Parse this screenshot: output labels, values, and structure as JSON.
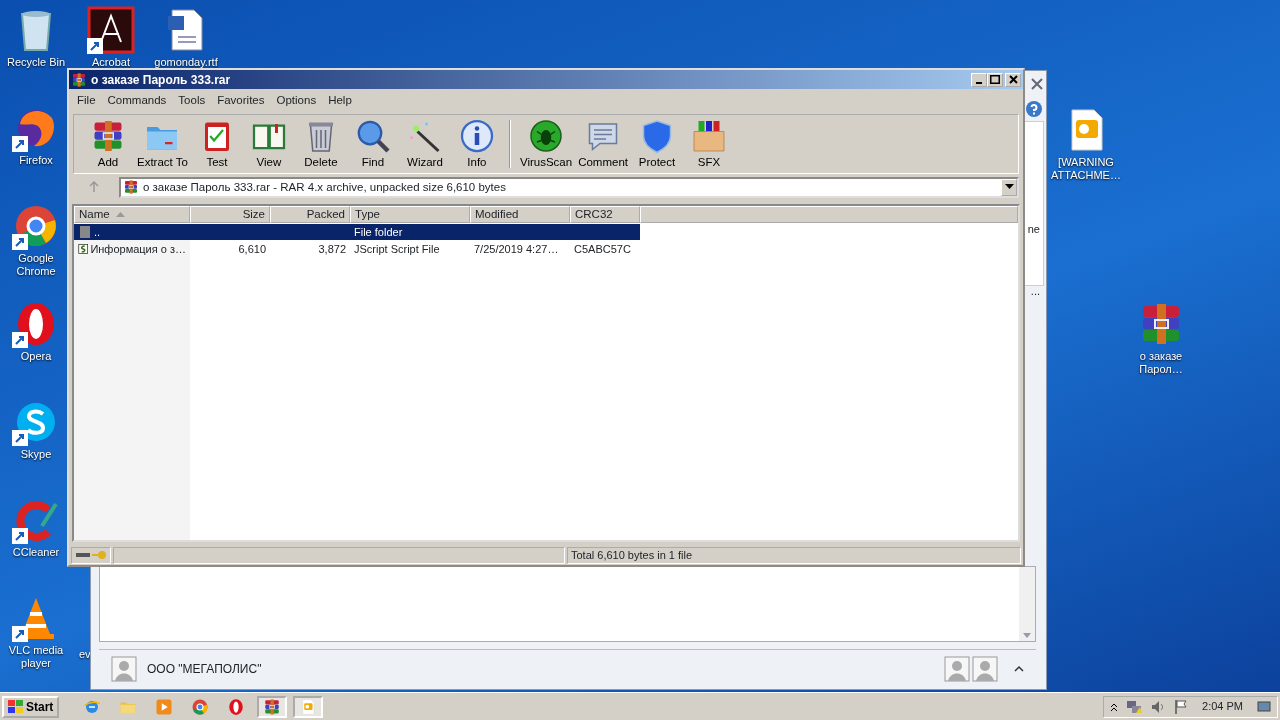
{
  "desktop_icons": [
    {
      "label": "Recycle Bin",
      "kind": "recycle",
      "shortcut": false
    },
    {
      "label": "Acrobat",
      "kind": "pdf",
      "shortcut": true
    },
    {
      "label": "gomonday.rtf",
      "kind": "doc",
      "shortcut": false
    },
    {
      "label": "Firefox",
      "kind": "firefox",
      "shortcut": true
    },
    {
      "label": "Google Chrome",
      "kind": "chrome",
      "shortcut": true
    },
    {
      "label": "Opera",
      "kind": "opera",
      "shortcut": true
    },
    {
      "label": "Skype",
      "kind": "skype",
      "shortcut": true
    },
    {
      "label": "CCleaner",
      "kind": "ccleaner",
      "shortcut": true
    },
    {
      "label": "VLC media player",
      "kind": "vlc",
      "shortcut": true
    },
    {
      "label": "ev",
      "kind": "hidden"
    },
    {
      "label": "[WARNING ATTACHME…",
      "kind": "outlook",
      "shortcut": false
    },
    {
      "label": "о заказе Парол…",
      "kind": "rar",
      "shortcut": false
    }
  ],
  "mail_window": {
    "fragments": [
      "ne",
      "..."
    ],
    "contact": "ООО \"МЕГАПОЛИС\""
  },
  "window": {
    "title": "о заказе Пароль 333.rar",
    "menu": [
      "File",
      "Commands",
      "Tools",
      "Favorites",
      "Options",
      "Help"
    ],
    "toolbar_groups": [
      [
        {
          "label": "Add",
          "kind": "add"
        },
        {
          "label": "Extract To",
          "kind": "extract"
        },
        {
          "label": "Test",
          "kind": "test"
        },
        {
          "label": "View",
          "kind": "view"
        },
        {
          "label": "Delete",
          "kind": "delete"
        },
        {
          "label": "Find",
          "kind": "find"
        },
        {
          "label": "Wizard",
          "kind": "wizard"
        },
        {
          "label": "Info",
          "kind": "info"
        }
      ],
      [
        {
          "label": "VirusScan",
          "kind": "virus"
        },
        {
          "label": "Comment",
          "kind": "comment"
        },
        {
          "label": "Protect",
          "kind": "protect"
        },
        {
          "label": "SFX",
          "kind": "sfx"
        }
      ]
    ],
    "path": "о заказе Пароль 333.rar - RAR 4.x archive, unpacked size 6,610 bytes",
    "table": {
      "columns": [
        {
          "label": "Name",
          "sorted": true
        },
        {
          "label": "Size",
          "sorted": false
        },
        {
          "label": "Packed",
          "sorted": false
        },
        {
          "label": "Type",
          "sorted": false
        },
        {
          "label": "Modified",
          "sorted": false
        },
        {
          "label": "CRC32",
          "sorted": false
        }
      ],
      "rows": [
        {
          "kind": "folder",
          "selected": true,
          "cells": [
            "..",
            "",
            "",
            "File folder",
            "",
            ""
          ]
        },
        {
          "kind": "script",
          "selected": false,
          "cells": [
            "Информация о з…",
            "6,610",
            "3,872",
            "JScript Script File",
            "7/25/2019 4:27…",
            "C5ABC57C"
          ]
        }
      ]
    },
    "status_bar": "Total 6,610 bytes in 1 file"
  },
  "taskbar": {
    "start": "Start",
    "apps": [
      {
        "kind": "ie",
        "active": false
      },
      {
        "kind": "explorer",
        "active": false
      },
      {
        "kind": "media",
        "active": false
      },
      {
        "kind": "chrome",
        "active": false
      },
      {
        "kind": "opera",
        "active": false
      },
      {
        "kind": "rar",
        "active": true
      },
      {
        "kind": "outlook",
        "active": true
      }
    ],
    "clock": "2:04 PM"
  }
}
